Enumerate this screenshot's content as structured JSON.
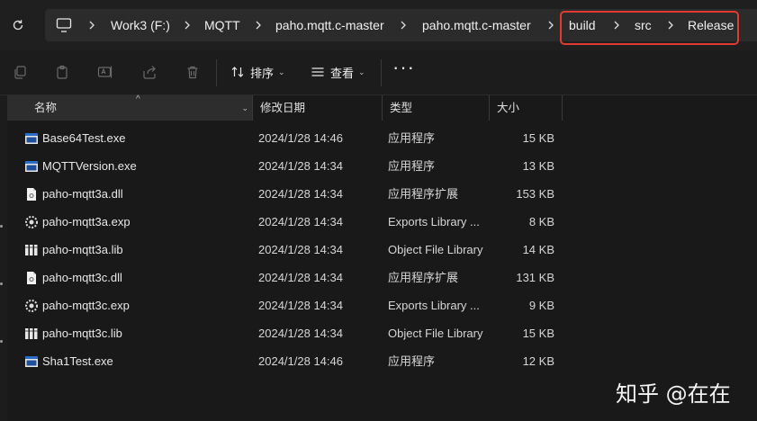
{
  "breadcrumb": {
    "items": [
      "Work3 (F:)",
      "MQTT",
      "paho.mqtt.c-master",
      "paho.mqtt.c-master",
      "build",
      "src",
      "Release"
    ]
  },
  "toolbar": {
    "sort_label": "排序",
    "view_label": "查看",
    "more_label": "···"
  },
  "columns": {
    "name": "名称",
    "date": "修改日期",
    "type": "类型",
    "size": "大小"
  },
  "files": [
    {
      "name": "Base64Test.exe",
      "date": "2024/1/28 14:46",
      "type": "应用程序",
      "size": "15 KB",
      "icon": "exe-icon"
    },
    {
      "name": "MQTTVersion.exe",
      "date": "2024/1/28 14:34",
      "type": "应用程序",
      "size": "13 KB",
      "icon": "exe-icon"
    },
    {
      "name": "paho-mqtt3a.dll",
      "date": "2024/1/28 14:34",
      "type": "应用程序扩展",
      "size": "153 KB",
      "icon": "dll-icon"
    },
    {
      "name": "paho-mqtt3a.exp",
      "date": "2024/1/28 14:34",
      "type": "Exports Library ...",
      "size": "8 KB",
      "icon": "exp-icon"
    },
    {
      "name": "paho-mqtt3a.lib",
      "date": "2024/1/28 14:34",
      "type": "Object File Library",
      "size": "14 KB",
      "icon": "lib-icon"
    },
    {
      "name": "paho-mqtt3c.dll",
      "date": "2024/1/28 14:34",
      "type": "应用程序扩展",
      "size": "131 KB",
      "icon": "dll-icon"
    },
    {
      "name": "paho-mqtt3c.exp",
      "date": "2024/1/28 14:34",
      "type": "Exports Library ...",
      "size": "9 KB",
      "icon": "exp-icon"
    },
    {
      "name": "paho-mqtt3c.lib",
      "date": "2024/1/28 14:34",
      "type": "Object File Library",
      "size": "15 KB",
      "icon": "lib-icon"
    },
    {
      "name": "Sha1Test.exe",
      "date": "2024/1/28 14:46",
      "type": "应用程序",
      "size": "12 KB",
      "icon": "exe-icon"
    }
  ],
  "watermark": "知乎 @在在",
  "colors": {
    "highlight_border": "#e23a2f",
    "background": "#1c1c1c",
    "exe_icon_blue": "#2b6cc4"
  }
}
